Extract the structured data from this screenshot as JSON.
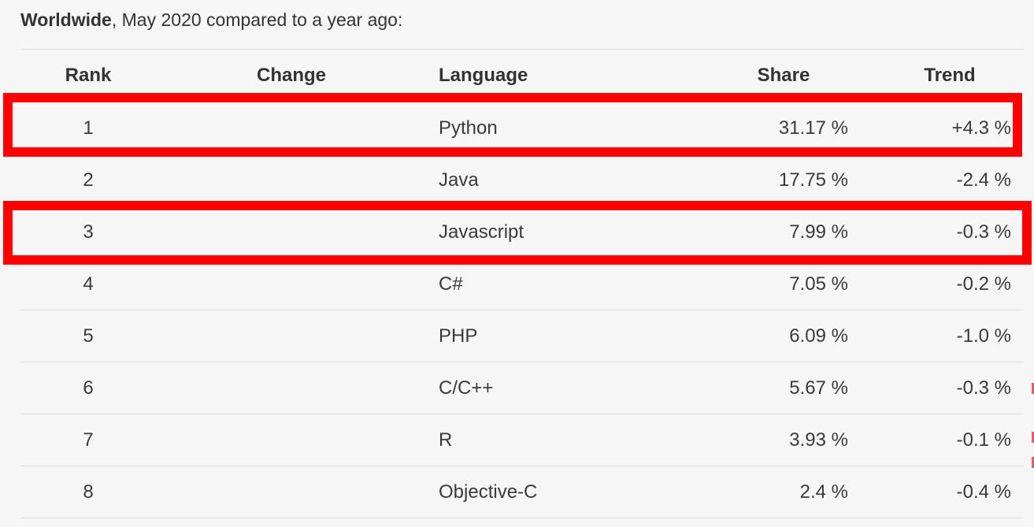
{
  "heading": {
    "region": "Worldwide",
    "rest": ", May 2020 compared to a year ago:"
  },
  "table": {
    "headers": {
      "rank": "Rank",
      "change": "Change",
      "language": "Language",
      "share": "Share",
      "trend": "Trend"
    },
    "rows": [
      {
        "rank": "1",
        "change": "",
        "language": "Python",
        "share": "31.17 %",
        "trend": "+4.3 %",
        "highlighted": true
      },
      {
        "rank": "2",
        "change": "",
        "language": "Java",
        "share": "17.75 %",
        "trend": "-2.4 %",
        "highlighted": false
      },
      {
        "rank": "3",
        "change": "",
        "language": "Javascript",
        "share": "7.99 %",
        "trend": "-0.3 %",
        "highlighted": true
      },
      {
        "rank": "4",
        "change": "",
        "language": "C#",
        "share": "7.05 %",
        "trend": "-0.2 %",
        "highlighted": false
      },
      {
        "rank": "5",
        "change": "",
        "language": "PHP",
        "share": "6.09 %",
        "trend": "-1.0 %",
        "highlighted": false
      },
      {
        "rank": "6",
        "change": "",
        "language": "C/C++",
        "share": "5.67 %",
        "trend": "-0.3 %",
        "highlighted": false
      },
      {
        "rank": "7",
        "change": "",
        "language": "R",
        "share": "3.93 %",
        "trend": "-0.1 %",
        "highlighted": false
      },
      {
        "rank": "8",
        "change": "",
        "language": "Objective-C",
        "share": "2.4 %",
        "trend": "-0.4 %",
        "highlighted": false
      }
    ]
  },
  "colors": {
    "background": "#f6f6f6",
    "text": "#333333",
    "highlight_border": "#ff0000",
    "row_divider": "#dedede"
  }
}
